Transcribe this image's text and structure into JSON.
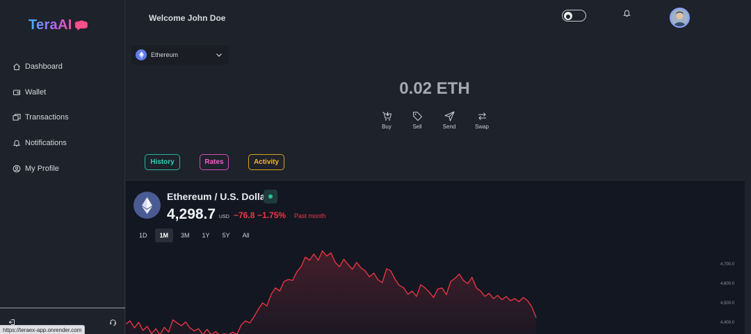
{
  "app": {
    "logo_text": "TeraAI",
    "welcome": "Welcome John Doe"
  },
  "sidebar": {
    "items": [
      {
        "label": "Dashboard",
        "icon": "home-icon"
      },
      {
        "label": "Wallet",
        "icon": "wallet-icon"
      },
      {
        "label": "Transactions",
        "icon": "transactions-icon"
      },
      {
        "label": "Notifications",
        "icon": "bell-icon"
      },
      {
        "label": "My Profile",
        "icon": "user-circle-icon"
      }
    ],
    "bottom_icons": [
      "logout-icon",
      "support-icon"
    ]
  },
  "status_bar": {
    "url": "https://teraex-app.onrender.com"
  },
  "coin_select": {
    "value": "Ethereum"
  },
  "balance": {
    "text": "0.02 ETH"
  },
  "actions": [
    "Buy",
    "Sell",
    "Send",
    "Swap"
  ],
  "tabs": [
    {
      "label": "History",
      "color": "#2ed1b8"
    },
    {
      "label": "Rates",
      "color": "#f05fd0"
    },
    {
      "label": "Activity",
      "color": "#f0b72a"
    }
  ],
  "widget": {
    "pair": "Ethereum / U.S. Dollar",
    "price": "4,298.7",
    "currency": "USD",
    "change": "−76.8",
    "change_pct": "−1.75%",
    "period": "Past month",
    "ranges": [
      "1D",
      "1M",
      "3M",
      "1Y",
      "5Y",
      "All"
    ],
    "active_range": "1M",
    "y_ticks": [
      "4,700.0",
      "4,600.0",
      "4,500.0",
      "4,400.0"
    ]
  },
  "chart_data": {
    "type": "area",
    "title": "",
    "ylabel": "",
    "ylim": [
      4340,
      4745
    ],
    "line_color": "#f23645",
    "series": [
      {
        "values": [
          4390,
          4405,
          4372,
          4398,
          4360,
          4380,
          4345,
          4368,
          4340,
          4375,
          4352,
          4410,
          4395,
          4382,
          4400,
          4372,
          4358,
          4368,
          4340,
          4365,
          4340,
          4355,
          4338,
          4345,
          4340,
          4352,
          4342,
          4385,
          4405,
          4395,
          4425,
          4460,
          4490,
          4475,
          4530,
          4560,
          4545,
          4590,
          4600,
          4595,
          4635,
          4660,
          4705,
          4690,
          4720,
          4690,
          4735,
          4710,
          4725,
          4680,
          4660,
          4695,
          4670,
          4648,
          4680,
          4655,
          4640,
          4612,
          4630,
          4598,
          4585,
          4650,
          4640,
          4600,
          4572,
          4560,
          4530,
          4545,
          4520,
          4575,
          4560,
          4540,
          4515,
          4555,
          4560,
          4528,
          4590,
          4605,
          4625,
          4595,
          4580,
          4610,
          4560,
          4545,
          4520,
          4535,
          4510,
          4525,
          4505,
          4520,
          4500,
          4510,
          4495,
          4515,
          4500,
          4470,
          4420
        ]
      }
    ]
  }
}
